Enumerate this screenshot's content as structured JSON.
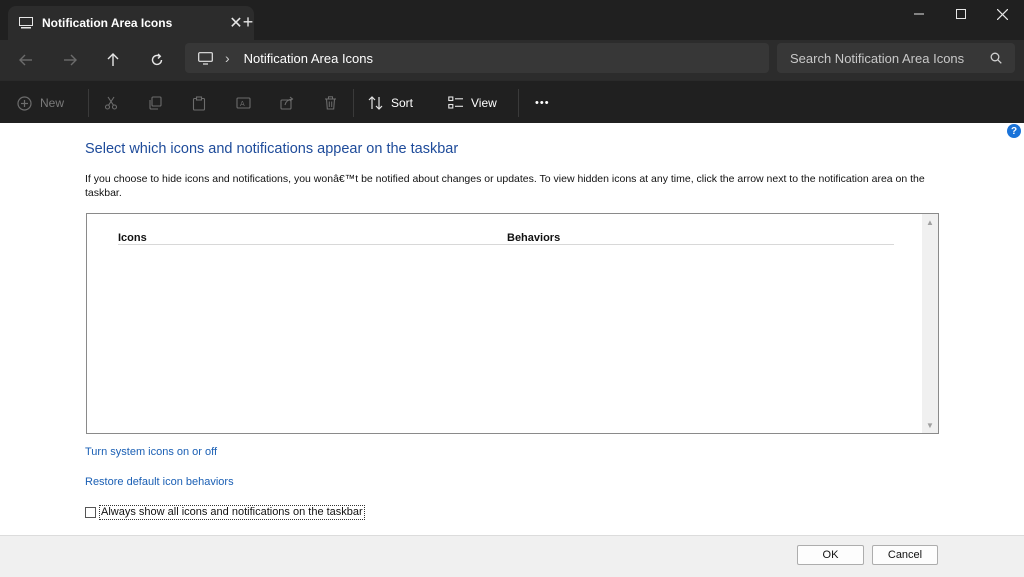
{
  "tab": {
    "title": "Notification Area Icons",
    "icon": "taskbar-icon",
    "close_label": "✕",
    "new_tab_label": "+"
  },
  "window_controls": {
    "minimize": "—",
    "maximize": "☐",
    "close": "✕"
  },
  "nav": {
    "back": "back-arrow-icon",
    "forward": "forward-arrow-icon",
    "up": "up-arrow-icon",
    "refresh": "refresh-icon"
  },
  "address": {
    "icon": "monitor-icon",
    "separator": "›",
    "path": "Notification Area Icons"
  },
  "search": {
    "placeholder": "Search Notification Area Icons"
  },
  "commands": {
    "new_label": "New",
    "sort_label": "Sort",
    "view_label": "View",
    "more_label": "•••"
  },
  "content": {
    "heading": "Select which icons and notifications appear on the taskbar",
    "description": "If you choose to hide icons and notifications, you wonâ€™t be notified about changes or updates. To view hidden icons at any time, click the arrow next to the notification area on the taskbar.",
    "columns": [
      "Icons",
      "Behaviors"
    ],
    "link_system_icons": "Turn system icons on or off",
    "link_restore": "Restore default icon behaviors",
    "checkbox_label": "Always show all icons and notifications on the taskbar",
    "checkbox_checked": false
  },
  "footer": {
    "ok_label": "OK",
    "cancel_label": "Cancel"
  },
  "colors": {
    "accent_link": "#1a5fb4",
    "heading": "#1e4b9a",
    "chrome_dark": "#202020",
    "help_blue": "#1a73d9"
  }
}
